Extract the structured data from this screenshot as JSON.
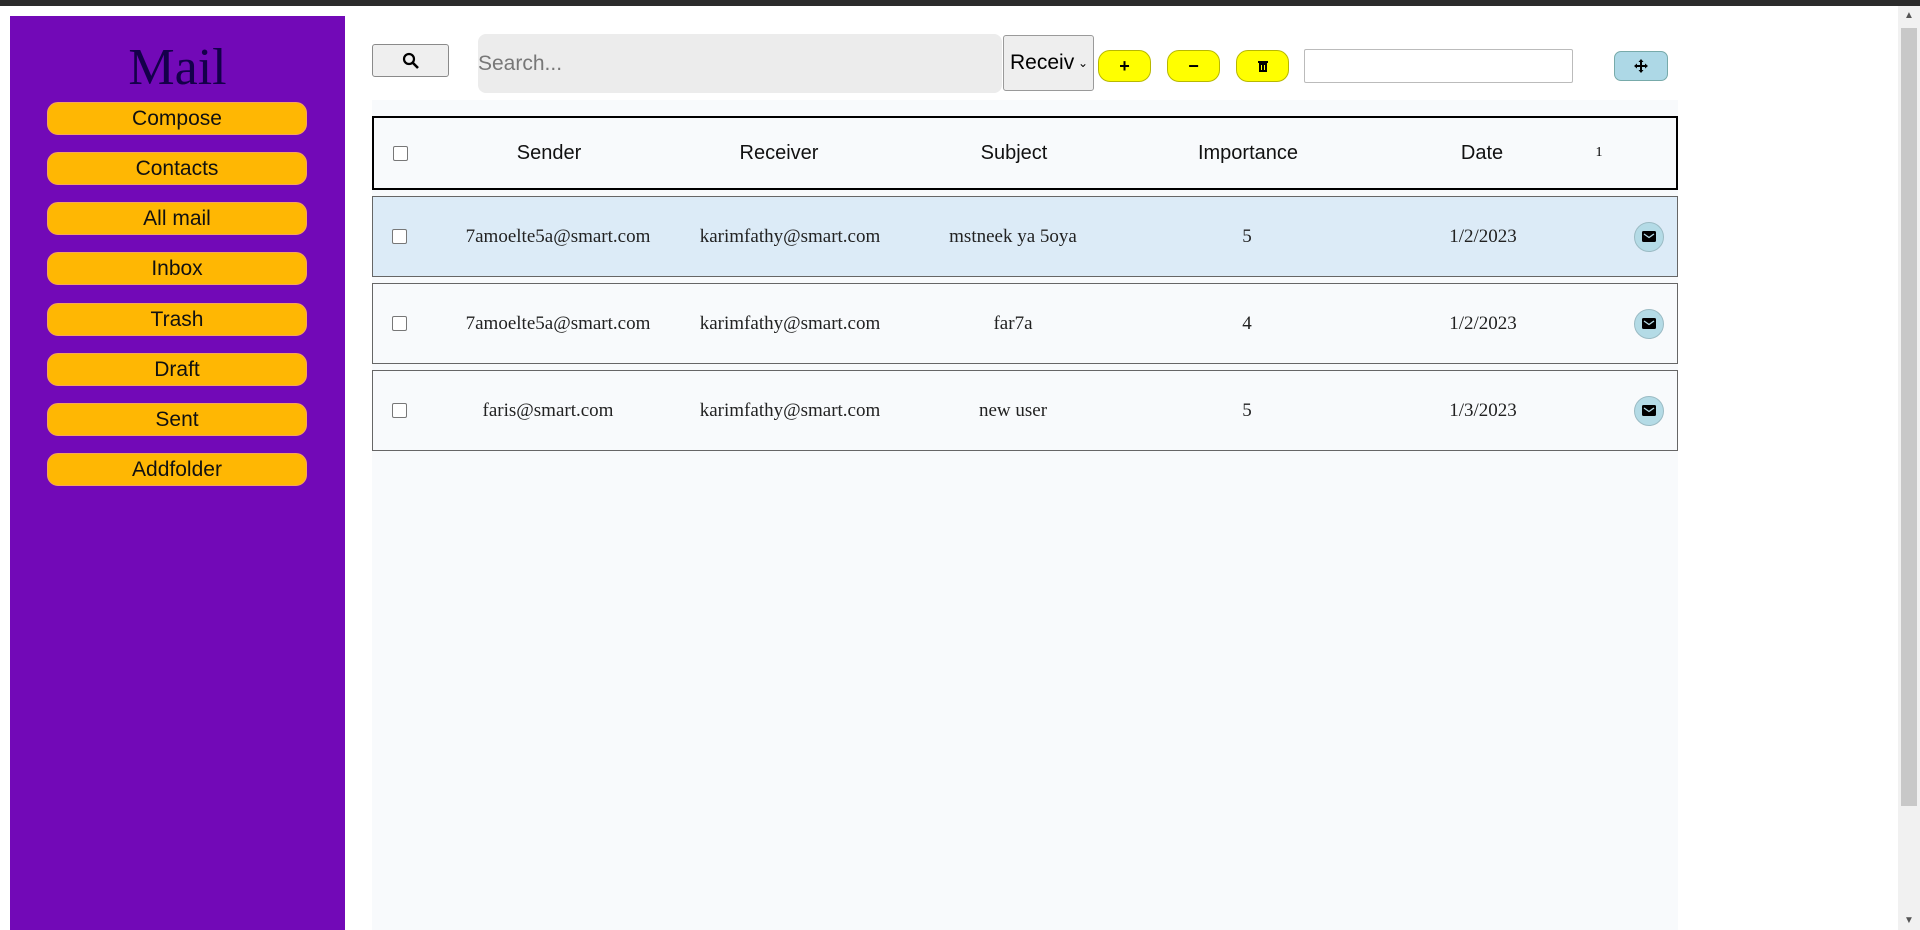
{
  "sidebar": {
    "title": "Mail",
    "items": [
      {
        "label": "Compose"
      },
      {
        "label": "Contacts"
      },
      {
        "label": "All mail"
      },
      {
        "label": "Inbox"
      },
      {
        "label": "Trash"
      },
      {
        "label": "Draft"
      },
      {
        "label": "Sent"
      },
      {
        "label": "Addfolder"
      }
    ]
  },
  "toolbar": {
    "search_placeholder": "Search...",
    "search_value": "",
    "sort_select": "Receiv",
    "add_label": "+",
    "remove_label": "−",
    "folder_input_value": ""
  },
  "table": {
    "headers": [
      "Sender",
      "Receiver",
      "Subject",
      "Importance",
      "Date"
    ],
    "page": "1",
    "rows": [
      {
        "sender": "7amoelte5a@smart.com",
        "receiver": "karimfathy@smart.com",
        "subject": "mstneek ya 5oya",
        "importance": "5",
        "date": "1/2/2023",
        "selected": true
      },
      {
        "sender": "7amoelte5a@smart.com",
        "receiver": "karimfathy@smart.com",
        "subject": "far7a",
        "importance": "4",
        "date": "1/2/2023"
      },
      {
        "sender": "faris@smart.com",
        "receiver": "karimfathy@smart.com",
        "subject": "new user",
        "importance": "5",
        "date": "1/3/2023"
      }
    ]
  },
  "colors": {
    "sidebar": "#7209b7",
    "nav_button": "#ffb703",
    "action_button": "#ffff00",
    "selected_row": "#dcebf7",
    "mail_button": "#b4dbe6"
  }
}
